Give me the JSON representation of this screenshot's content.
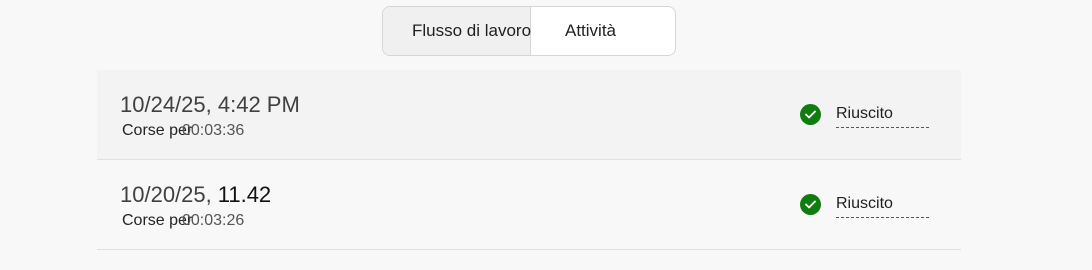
{
  "tabs": {
    "workflow": "Flusso di lavoro",
    "activity": "Attività"
  },
  "runs": [
    {
      "time": "10/24/25, 4:42 PM",
      "time_suffix": "",
      "label": "Corse per",
      "duration": "00:03:36",
      "status": "Riuscito"
    },
    {
      "time": "10/20/25,",
      "time_suffix": "11.42",
      "label": "Corse per",
      "duration": "00:03:26",
      "status": "Riuscito"
    }
  ],
  "colors": {
    "success": "#107c10",
    "background": "#f8f8f8",
    "row_highlight": "#f3f3f3"
  },
  "icons": {
    "status": "checkmark-circle-icon"
  }
}
